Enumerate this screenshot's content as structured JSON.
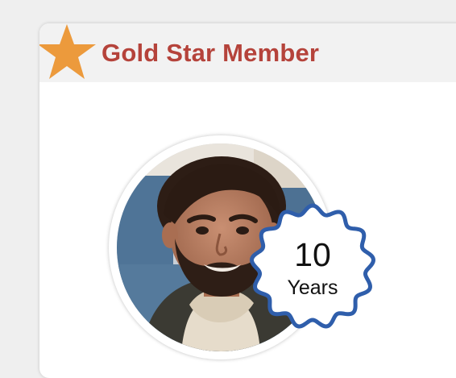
{
  "membership": {
    "title": "Gold Star Member",
    "tenure_number": "10",
    "tenure_unit": "Years"
  },
  "icons": {
    "badge_icon": "star-icon",
    "tenure_badge": "scalloped-badge"
  },
  "colors": {
    "title_red": "#b5433b",
    "star_orange": "#ec9a3c",
    "badge_border_blue": "#2f5eab",
    "header_bg": "#f2f2f2"
  }
}
